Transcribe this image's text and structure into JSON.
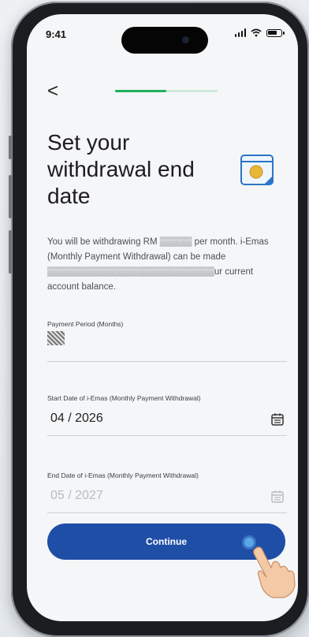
{
  "status_bar": {
    "time": "9:41"
  },
  "header": {
    "back_label": "<",
    "progress_fraction": 0.5
  },
  "page": {
    "title": "Set your\nwithdrawal end\ndate",
    "description": "You will be withdrawing RM ▒▒▒▒▒ per month. i-Emas (Monthly Payment Withdrawal) can be made ▒▒▒▒▒▒▒▒▒▒▒▒▒▒▒▒▒▒▒▒▒▒▒▒▒▒ur current account balance."
  },
  "form": {
    "payment_period_label": "Payment Period (Months)",
    "start_date_label": "Start Date of i-Emas (Monthly Payment Withdrawal)",
    "start_date_value": "04 / 2026",
    "end_date_label": "End Date of i-Emas (Monthly Payment Withdrawal)",
    "end_date_value": "05 / 2027"
  },
  "actions": {
    "continue_label": "Continue"
  },
  "colors": {
    "accent": "#1f4ea7",
    "progress": "#1fb05a",
    "icon": "#2c74c7"
  }
}
